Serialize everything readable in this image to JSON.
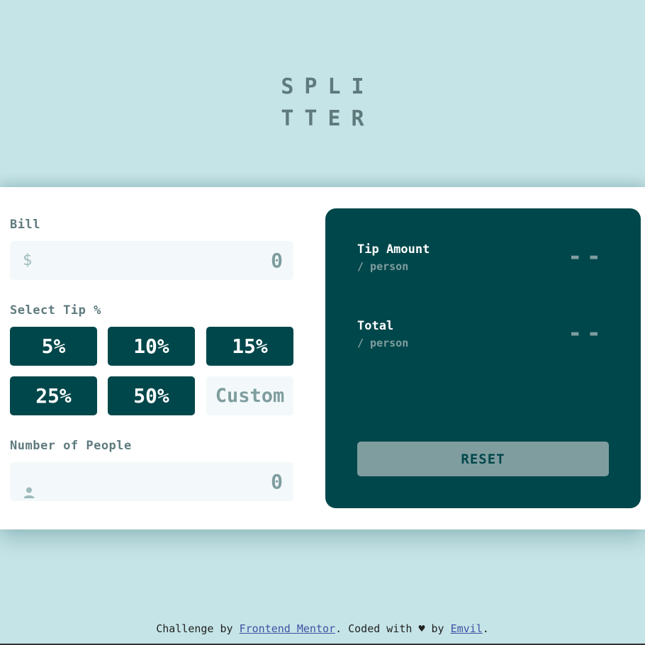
{
  "logo": {
    "line1": "SPLI",
    "line2": "TTER"
  },
  "bill": {
    "label": "Bill",
    "icon": "dollar-icon",
    "icon_glyph": "$",
    "value": "0"
  },
  "tip": {
    "label": "Select Tip %",
    "options": [
      "5%",
      "10%",
      "15%",
      "25%",
      "50%"
    ],
    "custom_placeholder": "Custom"
  },
  "people": {
    "label": "Number of People",
    "icon": "person-icon",
    "value": "0"
  },
  "results": {
    "tip_amount_label": "Tip Amount",
    "tip_amount_sub": "/ person",
    "tip_amount_value": "--",
    "total_label": "Total",
    "total_sub": "/ person",
    "total_value": "--",
    "reset_label": "RESET"
  },
  "footer": {
    "prefix": "Challenge by ",
    "link1": "Frontend Mentor",
    "middle": ". Coded with ♥ by ",
    "link2": "Emvil",
    "suffix": "."
  },
  "colors": {
    "background": "#c5e4e7",
    "primary": "#00474b",
    "muted": "#7f9d9f",
    "input_bg": "#f3f9fa"
  }
}
